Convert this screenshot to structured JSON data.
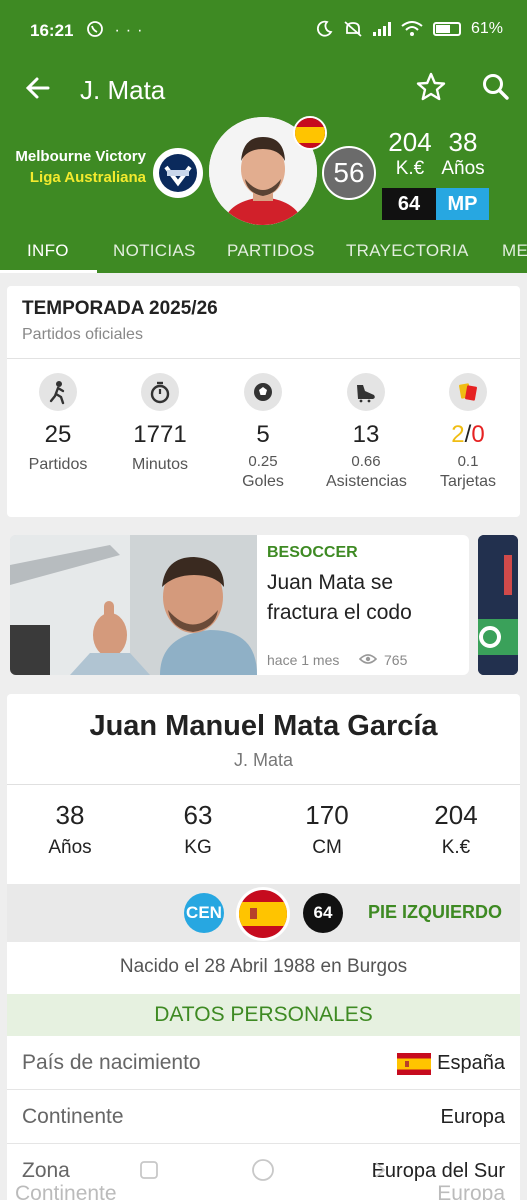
{
  "status_bar": {
    "time": "16:21",
    "left_icons": [
      "whatsapp-icon",
      "more-dots-icon"
    ],
    "more_dots": "···",
    "battery": "61%",
    "right_icons": [
      "moon-icon",
      "mute-icon",
      "signal-icon",
      "wifi-icon",
      "battery-icon"
    ]
  },
  "toolbar": {
    "title": "J. Mata",
    "icons": [
      "back-arrow-icon",
      "star-icon",
      "search-icon"
    ]
  },
  "player_header": {
    "club": "Melbourne Victory",
    "league": "Liga Australiana",
    "rating": "56",
    "value": "204",
    "value_unit": "K.€",
    "age": "38",
    "age_unit": "Años",
    "media": "64",
    "position": "MP"
  },
  "tabs": [
    "INFO",
    "NOTICIAS",
    "PARTIDOS",
    "TRAYECTORIA",
    "ME"
  ],
  "season": {
    "title": "TEMPORADA 2025/26",
    "subtitle": "Partidos oficiales",
    "stats": [
      {
        "icon": "player-icon",
        "value": "25",
        "label": "Partidos",
        "sub": ""
      },
      {
        "icon": "stopwatch-icon",
        "value": "1771",
        "label": "Minutos",
        "sub": ""
      },
      {
        "icon": "ball-icon",
        "value": "5",
        "label": "Goles",
        "sub": "0.25"
      },
      {
        "icon": "boot-icon",
        "value": "13",
        "label": "Asistencias",
        "sub": "0.66"
      },
      {
        "icon": "cards-icon",
        "value": "",
        "label": "Tarjetas",
        "sub": "0.1"
      }
    ],
    "cards": {
      "yellow": "2",
      "separator": "/",
      "red": "0"
    }
  },
  "news": {
    "source": "BESOCCER",
    "title": "Juan Mata se fractura el codo",
    "time": "hace 1 mes",
    "views": "765"
  },
  "profile": {
    "full_name": "Juan Manuel Mata García",
    "short_name": "J. Mata",
    "stats": [
      {
        "value": "38",
        "label": "Años"
      },
      {
        "value": "63",
        "label": "KG"
      },
      {
        "value": "170",
        "label": "CM"
      },
      {
        "value": "204",
        "label": "K.€"
      }
    ],
    "position_code": "CEN",
    "media": "64",
    "foot": "PIE IZQUIERDO",
    "born": "Nacido el 28 Abril 1988 en Burgos",
    "section_title": "DATOS PERSONALES",
    "rows": [
      {
        "key": "País de nacimiento",
        "value": "España"
      },
      {
        "key": "Continente",
        "value": "Europa"
      },
      {
        "key": "Zona",
        "value": "Europa del Sur"
      }
    ],
    "ghost_row": {
      "key": "Continente",
      "value": "Europa"
    }
  },
  "colors": {
    "brand_green": "#3e8a23",
    "league_yellow": "#f3ea2e",
    "position_blue": "#27a7e1",
    "yellow_card": "#f0bd13",
    "red_card": "#e62222"
  }
}
